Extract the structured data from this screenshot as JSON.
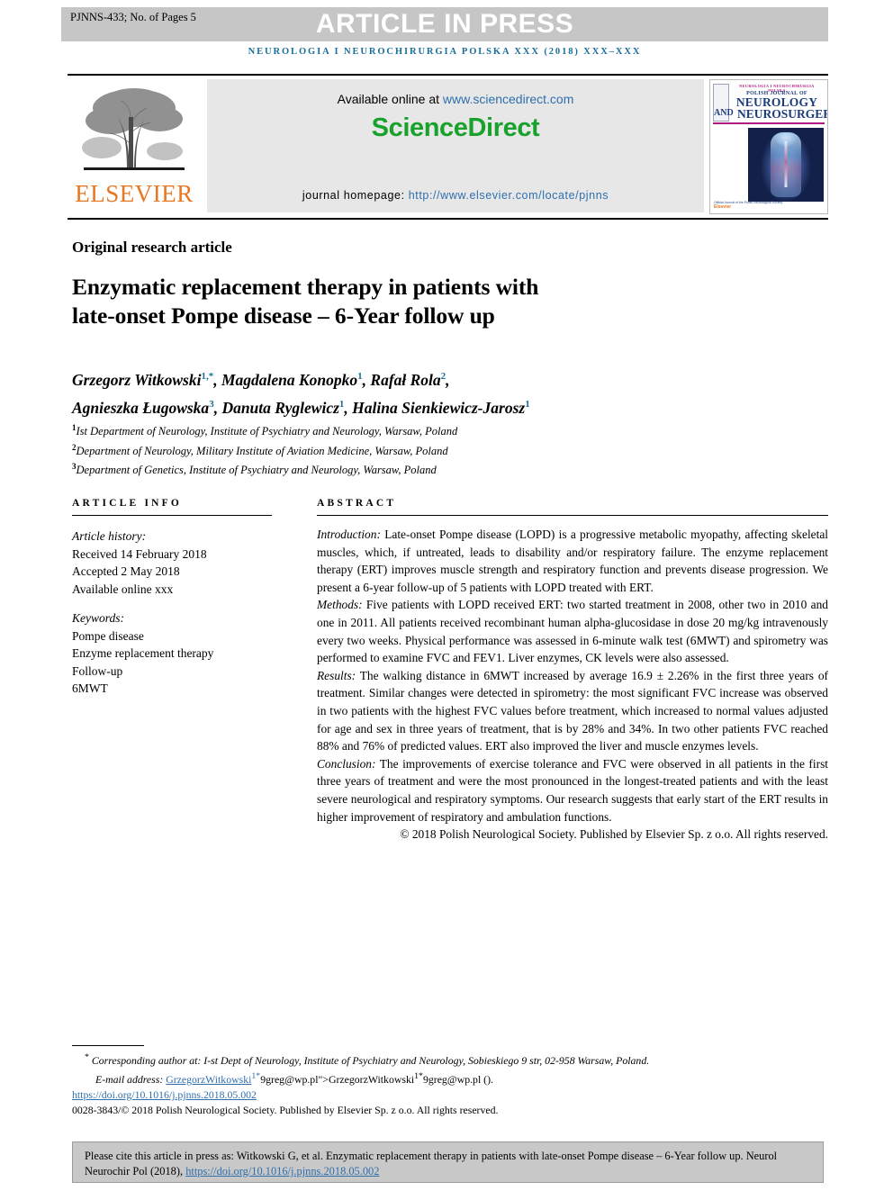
{
  "header": {
    "press_code": "PJNNS-433; No. of Pages 5",
    "press_label": "ARTICLE IN PRESS",
    "running_head": "NEUROLOGIA I NEUROCHIRURGIA POLSKA XXX (2018) XXX–XXX"
  },
  "masthead": {
    "elsevier_wordmark": "ELSEVIER",
    "available_prefix": "Available online at ",
    "available_link": "www.sciencedirect.com",
    "sciencedirect_logo": "ScienceDirect",
    "homepage_prefix": "journal homepage: ",
    "homepage_link": "http://www.elsevier.com/locate/pjnns",
    "cover": {
      "top_line": "NEUROLOGIA I NEUROCHIRURGIA POLSKA",
      "polish_journal_of": "POLISH JOURNAL OF",
      "neurology": "NEUROLOGY",
      "and": "AND",
      "neurosurgery": "NEUROSURGERY",
      "footer_small": "Official Journal of the Polish Neurological Society",
      "footer_publisher": "Elsevier"
    }
  },
  "article": {
    "type": "Original research article",
    "title_line1": "Enzymatic replacement therapy in patients with",
    "title_line2": "late-onset Pompe disease – 6-Year follow up"
  },
  "authors": {
    "line1": "Grzegorz Witkowski",
    "line1_sup": "1,*",
    "line1b": ", Magdalena Konopko",
    "line1b_sup": "1",
    "line1c": ", Rafał Rola",
    "line1c_sup": "2",
    "line1d": ",",
    "line2": "Agnieszka Ługowska",
    "line2_sup": "3",
    "line2b": ", Danuta Ryglewicz",
    "line2b_sup": "1",
    "line2c": ", Halina Sienkiewicz-Jarosz",
    "line2c_sup": "1",
    "affiliations": [
      {
        "sup": "1",
        "text": "Ist Department of Neurology, Institute of Psychiatry and Neurology, Warsaw, Poland"
      },
      {
        "sup": "2",
        "text": "Department of Neurology, Military Institute of Aviation Medicine, Warsaw, Poland"
      },
      {
        "sup": "3",
        "text": "Department of Genetics, Institute of Psychiatry and Neurology, Warsaw, Poland"
      }
    ]
  },
  "article_info": {
    "heading": "ARTICLE INFO",
    "history_label": "Article history:",
    "received": "Received 14 February 2018",
    "accepted": "Accepted 2 May 2018",
    "available_online": "Available online xxx",
    "keywords_label": "Keywords:",
    "keywords": [
      "Pompe disease",
      "Enzyme replacement therapy",
      "Follow-up",
      "6MWT"
    ]
  },
  "abstract": {
    "heading": "ABSTRACT",
    "sections": [
      {
        "lead": "Introduction:",
        "text": " Late-onset Pompe disease (LOPD) is a progressive metabolic myopathy, affecting skeletal muscles, which, if untreated, leads to disability and/or respiratory failure. The enzyme replacement therapy (ERT) improves muscle strength and respiratory function and prevents disease progression. We present a 6-year follow-up of 5 patients with LOPD treated with ERT."
      },
      {
        "lead": "Methods:",
        "text": " Five patients with LOPD received ERT: two started treatment in 2008, other two in 2010 and one in 2011. All patients received recombinant human alpha-glucosidase in dose 20 mg/kg intravenously every two weeks. Physical performance was assessed in 6-minute walk test (6MWT) and spirometry was performed to examine FVC and FEV1. Liver enzymes, CK levels were also assessed."
      },
      {
        "lead": "Results:",
        "text": " The walking distance in 6MWT increased by average 16.9 ± 2.26% in the first three years of treatment. Similar changes were detected in spirometry: the most significant FVC increase was observed in two patients with the highest FVC values before treatment, which increased to normal values adjusted for age and sex in three years of treatment, that is by 28% and 34%. In two other patients FVC reached 88% and 76% of predicted values. ERT also improved the liver and muscle enzymes levels."
      },
      {
        "lead": "Conclusion:",
        "text": " The improvements of exercise tolerance and FVC were observed in all patients in the first three years of treatment and were the most pronounced in the longest-treated patients and with the least severe neurological and respiratory symptoms. Our research suggests that early start of the ERT results in higher improvement of respiratory and ambulation functions."
      }
    ],
    "copyright": "© 2018 Polish Neurological Society. Published by Elsevier Sp. z o.o. All rights reserved."
  },
  "footnotes": {
    "corresponding": "Corresponding author at: I-st Dept of Neurology, Institute of Psychiatry and Neurology, Sobieskiego 9 str, 02-958 Warsaw, Poland.",
    "email_label": "E-mail address: ",
    "email_link": "GrzegorzWitkowski",
    "email_sup": "1*",
    "email_rest": "9greg@wp.pl\">GrzegorzWitkowski",
    "email_sup2": "1*",
    "email_tail": "9greg@wp.pl ().",
    "doi": "https://doi.org/10.1016/j.pjnns.2018.05.002",
    "issn_line": "0028-3843/© 2018 Polish Neurological Society. Published by Elsevier Sp. z o.o. All rights reserved."
  },
  "cite_box": {
    "text_before": "Please cite this article in press as: Witkowski G, et al. Enzymatic replacement therapy in patients with late-onset Pompe disease – 6-Year follow up. Neurol Neurochir Pol (2018), ",
    "doi": "https://doi.org/10.1016/j.pjnns.2018.05.002"
  },
  "colors": {
    "journal_blue": "#1a6e9c",
    "link_blue": "#2f6fad",
    "sciencedirect_green": "#19a22b",
    "elsevier_orange": "#e87722",
    "band_gray": "#c6c6c6",
    "cite_gray": "#c8c8c8"
  }
}
